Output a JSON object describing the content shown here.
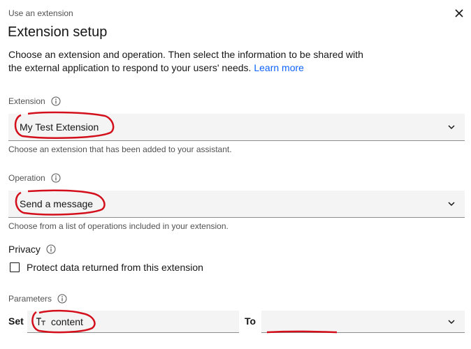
{
  "header": {
    "eyebrow": "Use an extension",
    "title": "Extension setup",
    "description": "Choose an extension and operation. Then select the information to be shared with the external application to respond to your users' needs.",
    "learn_more": "Learn more",
    "close_icon": "close-icon"
  },
  "extension": {
    "label": "Extension",
    "value": "My Test Extension",
    "helper": "Choose an extension that has been added to your assistant."
  },
  "operation": {
    "label": "Operation",
    "value": "Send a message",
    "helper": "Choose from a list of operations included in your extension."
  },
  "privacy": {
    "label": "Privacy",
    "checkbox_label": "Protect data returned from this extension",
    "checked": false
  },
  "parameters": {
    "label": "Parameters",
    "set_label": "Set",
    "param_value": "content",
    "to_label": "To",
    "to_value": ""
  },
  "colors": {
    "link": "#0f62fe",
    "annotation": "#d30f1b",
    "field_bg": "#f4f4f4"
  }
}
